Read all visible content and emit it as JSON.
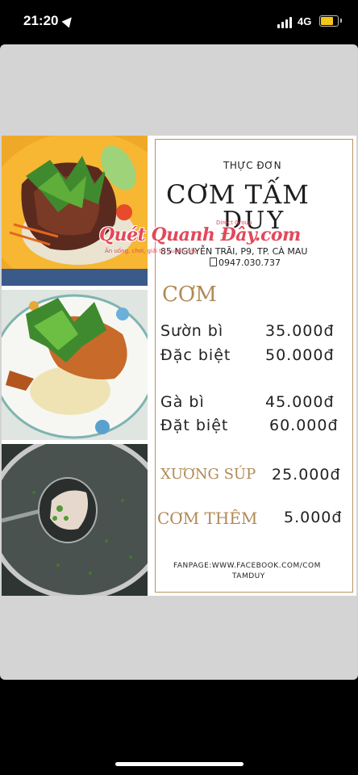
{
  "status_bar": {
    "time": "21:20",
    "network": "4G",
    "icons": [
      "location-arrow-icon",
      "signal-bars-icon",
      "battery-icon"
    ],
    "battery_color": "#f5c518"
  },
  "menu": {
    "heading": "THỰC ĐƠN",
    "restaurant_name_line1": "CƠM TẤM",
    "restaurant_name_line2": "DUY",
    "address": "85 NGUYỄN TRÃI, P9, TP. CÀ MAU",
    "phone": "0947.030.737",
    "section_title": "CƠM",
    "accent_color": "#b08a55",
    "items": [
      {
        "name": "Sườn bì",
        "price": "35.000đ"
      },
      {
        "name": "Đặc biệt",
        "price": "50.000đ"
      },
      {
        "name": "Gà bì",
        "price": "45.000đ"
      },
      {
        "name": "Đặt biệt",
        "price": "60.000đ"
      }
    ],
    "extras": [
      {
        "name": "XƯƠNG SÚP",
        "price": "25.000đ"
      },
      {
        "name": "CƠM THÊM",
        "price": "5.000đ"
      }
    ],
    "fanpage_line1": "FANPAGE:WWW.FACEBOOK.COM/COM",
    "fanpage_line2": "TAMDUY"
  },
  "watermark": {
    "text": "Quét Quanh Đây.com",
    "subtext": "Ăn uống, chơi, giải trí quanh đây",
    "top_text": "Direct Group"
  },
  "photos": [
    {
      "subject": "grilled pork chop on broken rice with herbs"
    },
    {
      "subject": "broken rice with chicken and herbs"
    },
    {
      "subject": "bowl of bone soup with spoon"
    }
  ]
}
